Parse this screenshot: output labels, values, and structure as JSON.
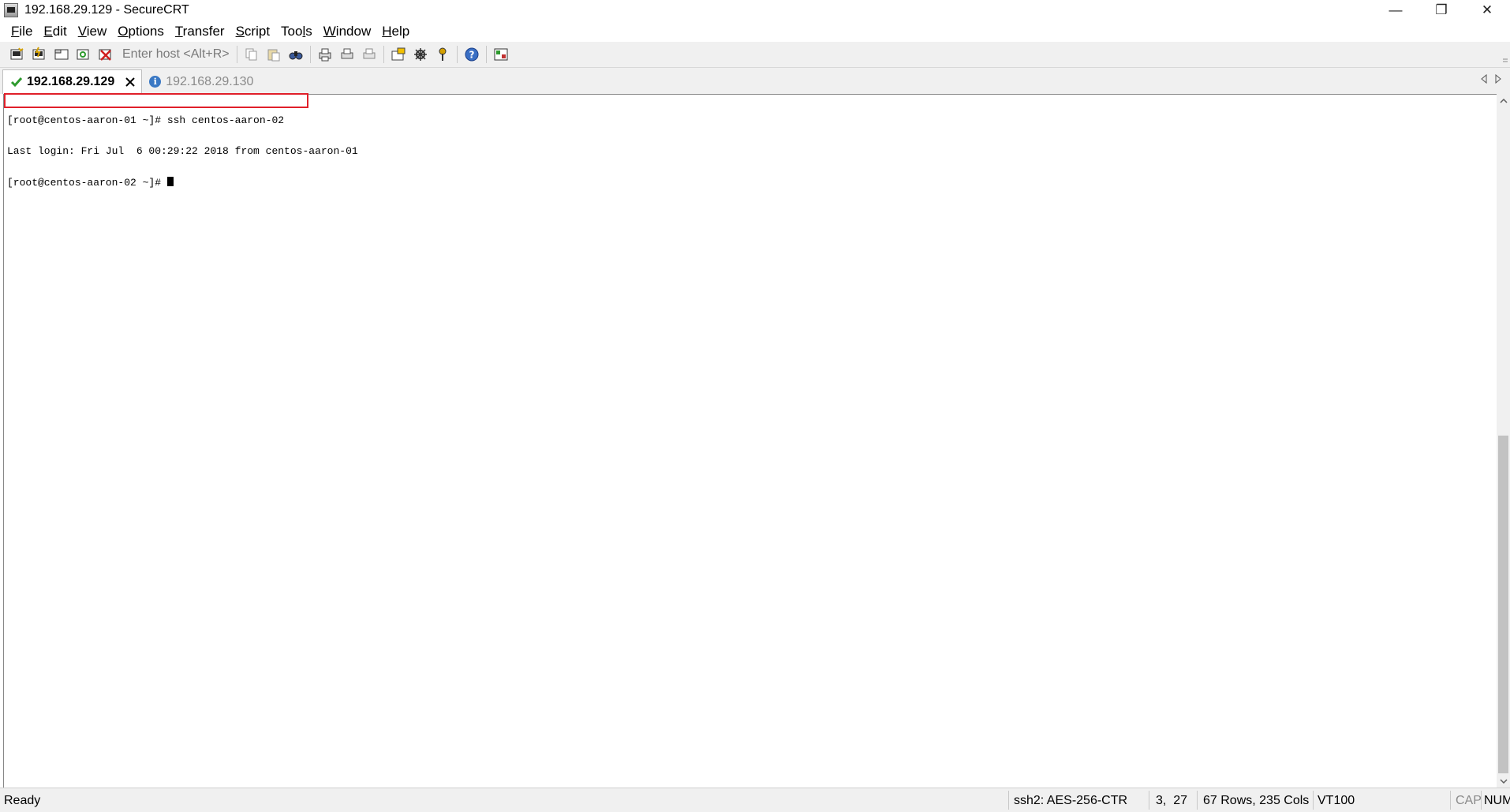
{
  "window": {
    "title": "192.168.29.129 - SecureCRT",
    "minimize_glyph": "—",
    "restore_glyph": "❐",
    "close_glyph": "✕"
  },
  "menu": {
    "items": [
      {
        "accel": "F",
        "rest": "ile"
      },
      {
        "accel": "E",
        "rest": "dit"
      },
      {
        "accel": "V",
        "rest": "iew"
      },
      {
        "accel": "O",
        "rest": "ptions"
      },
      {
        "accel": "T",
        "rest": "ransfer"
      },
      {
        "accel": "S",
        "rest": "cript"
      },
      {
        "accel": "l",
        "pre": "Too",
        "rest": "s"
      },
      {
        "accel": "W",
        "rest": "indow"
      },
      {
        "accel": "H",
        "rest": "elp"
      }
    ]
  },
  "toolbar": {
    "enter_host_placeholder": "Enter host <Alt+R>"
  },
  "tabs": {
    "active": {
      "label": "192.168.29.129",
      "status": "connected"
    },
    "inactive": {
      "label": "192.168.29.130",
      "status": "info"
    }
  },
  "terminal": {
    "lines": [
      "[root@centos-aaron-01 ~]# ssh centos-aaron-02",
      "Last login: Fri Jul  6 00:29:22 2018 from centos-aaron-01",
      "[root@centos-aaron-02 ~]# "
    ]
  },
  "status": {
    "ready": "Ready",
    "cipher": "ssh2: AES-256-CTR",
    "cursor_pos": "3,  27",
    "dimensions": "67 Rows, 235 Cols",
    "emulation": "VT100",
    "cap": "CAP",
    "num": "NUM"
  },
  "colors": {
    "highlight_border": "#e0202a",
    "info_icon": "#3a78c4",
    "connected_check": "#2e9a2e"
  }
}
